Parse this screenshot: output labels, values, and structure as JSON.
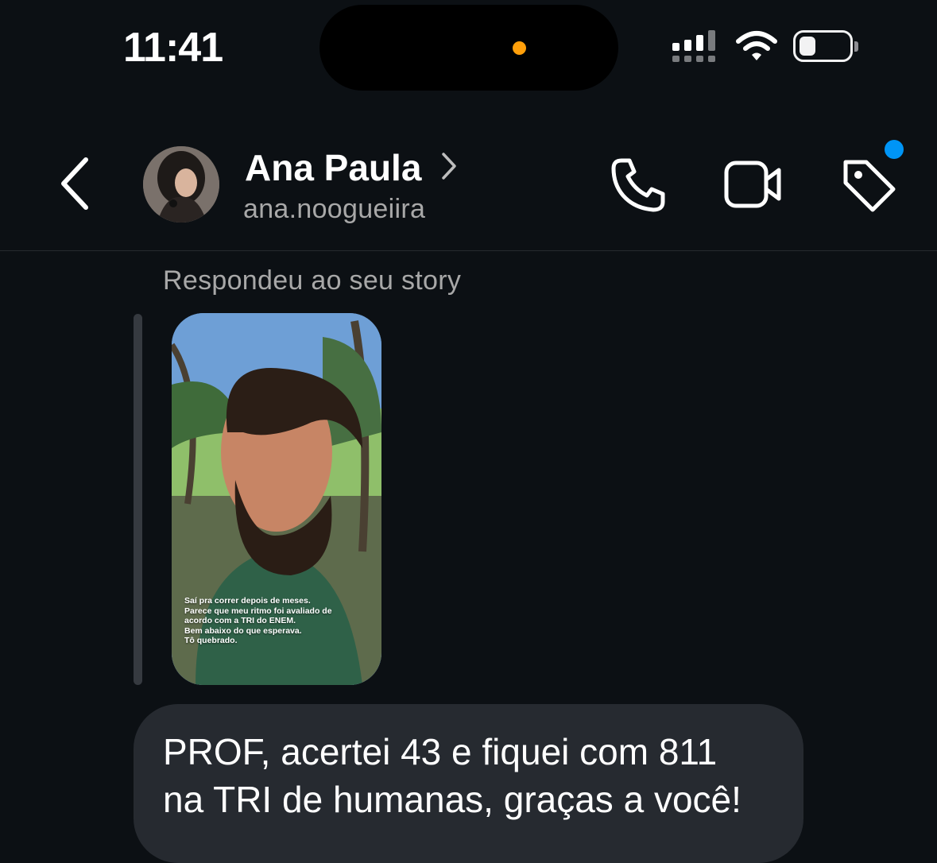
{
  "status_bar": {
    "time": "11:41",
    "battery_level": 0.25
  },
  "header": {
    "name": "Ana Paula",
    "username": "ana.noogueiira",
    "icons": [
      "back-chevron-icon",
      "profile-chevron-icon",
      "phone-icon",
      "video-camera-icon",
      "tag-icon"
    ],
    "badge_color": "#0095f6"
  },
  "chat": {
    "reply_label": "Respondeu ao seu story",
    "story_caption_lines": [
      "Saí pra correr depois de meses.",
      "Parece que meu ritmo foi avaliado de",
      "acordo com a TRI do ENEM.",
      "Bem abaixo do que esperava.",
      "Tô quebrado."
    ],
    "message_line_1": "PROF, acertei 43 e fiquei com 811",
    "message_line_2": "na TRI de humanas, graças a você!"
  },
  "colors": {
    "background": "#0c1014",
    "bubble": "#262a30",
    "secondary_text": "#a8a8a8",
    "dynamic_island_dot": "#ff9f0a"
  }
}
